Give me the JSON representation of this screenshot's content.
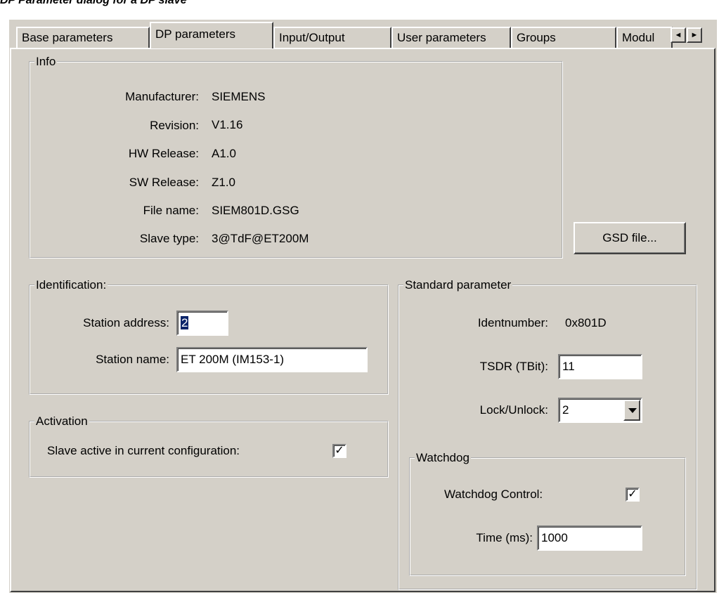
{
  "caption": "DP Parameter dialog for a DP slave",
  "tabs": [
    {
      "label": "Base parameters"
    },
    {
      "label": "DP parameters"
    },
    {
      "label": "Input/Output"
    },
    {
      "label": "User parameters"
    },
    {
      "label": "Groups"
    },
    {
      "label": "Modul"
    }
  ],
  "info": {
    "title": "Info",
    "manufacturer_label": "Manufacturer:",
    "manufacturer": "SIEMENS",
    "revision_label": "Revision:",
    "revision": "V1.16",
    "hw_label": "HW Release:",
    "hw": "A1.0",
    "sw_label": "SW Release:",
    "sw": "Z1.0",
    "file_label": "File name:",
    "file": "SIEM801D.GSG",
    "slave_type_label": "Slave type:",
    "slave_type": "3@TdF@ET200M"
  },
  "gsd_button": "GSD file...",
  "identification": {
    "title": "Identification:",
    "station_address_label": "Station address:",
    "station_address": "2",
    "station_name_label": "Station name:",
    "station_name": "ET 200M (IM153-1)"
  },
  "activation": {
    "title": "Activation",
    "slave_active_label": "Slave active in current configuration:",
    "slave_active": "✓"
  },
  "standard": {
    "title": "Standard parameter",
    "identnumber_label": "Identnumber:",
    "identnumber": "0x801D",
    "tsdr_label": "TSDR (TBit):",
    "tsdr": "11",
    "lock_label": "Lock/Unlock:",
    "lock": "2"
  },
  "watchdog": {
    "title": "Watchdog",
    "control_label": "Watchdog Control:",
    "control": "✓",
    "time_label": "Time (ms):",
    "time": "1000"
  },
  "icons": {
    "scroll_left": "◄",
    "scroll_right": "►"
  }
}
